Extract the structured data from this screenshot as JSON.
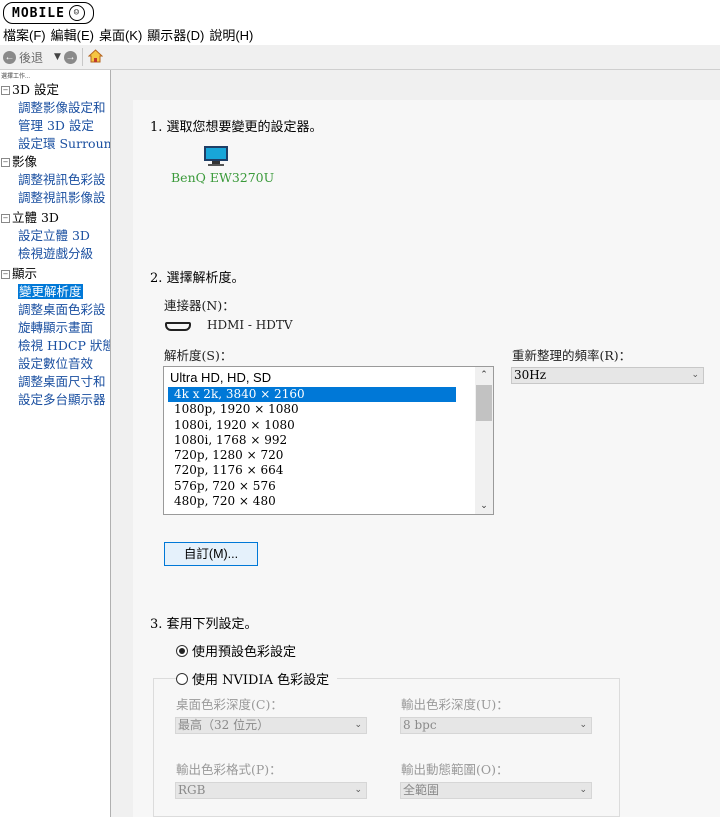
{
  "logo": {
    "text": "MOBILE",
    "face": "☺"
  },
  "menu": {
    "items": [
      "檔案(F)",
      "編輯(E)",
      "桌面(K)",
      "顯示器(D)",
      "說明(H)"
    ]
  },
  "toolbar": {
    "back_label": "後退",
    "back_icon": "arrow-left-icon",
    "forward_icon": "arrow-right-icon",
    "home_icon": "home-icon"
  },
  "sidebar": {
    "caption": "選擇工作...",
    "categories": [
      {
        "label": "3D 設定",
        "items": [
          "調整影像設定和",
          "管理 3D 設定",
          "設定環 Surround"
        ]
      },
      {
        "label": "影像",
        "items": [
          "調整視訊色彩設",
          "調整視訊影像設"
        ]
      },
      {
        "label": "立體 3D",
        "items": [
          "設定立體 3D",
          "檢視遊戲分級"
        ]
      },
      {
        "label": "顯示",
        "items": [
          "變更解析度",
          "調整桌面色彩設",
          "旋轉顯示畫面",
          "檢視 HDCP 狀態",
          "設定數位音效",
          "調整桌面尺寸和",
          "設定多台顯示器"
        ]
      }
    ],
    "selected": "變更解析度"
  },
  "main": {
    "step1": {
      "title": "1. 選取您想要變更的設定器。",
      "monitor_name": "BenQ EW3270U"
    },
    "step2": {
      "title": "2. 選擇解析度。",
      "connector_label": "連接器(N)：",
      "connector_value": "HDMI - HDTV",
      "resolution_label": "解析度(S)：",
      "refresh_label": "重新整理的頻率(R)：",
      "refresh_value": "30Hz",
      "resolution_group": "Ultra HD, HD, SD",
      "resolutions": [
        "4k x 2k, 3840 × 2160",
        "1080p, 1920 × 1080",
        "1080i, 1920 × 1080",
        "1080i, 1768 × 992",
        "720p, 1280 × 720",
        "720p, 1176 × 664",
        "576p, 720 × 576",
        "480p, 720 × 480"
      ],
      "selected_resolution": "4k x 2k, 3840 × 2160",
      "custom_button": "自訂(M)..."
    },
    "step3": {
      "title": "3. 套用下列設定。",
      "radio_default": "使用預設色彩設定",
      "radio_nvidia": "使用 NVIDIA 色彩設定",
      "selected_radio": "default",
      "desktop_depth_label": "桌面色彩深度(C)：",
      "desktop_depth_value": "最高（32 位元）",
      "output_depth_label": "輸出色彩深度(U)：",
      "output_depth_value": "8 bpc",
      "output_format_label": "輸出色彩格式(P)：",
      "output_format_value": "RGB",
      "dynamic_range_label": "輸出動態範圍(O)：",
      "dynamic_range_value": "全範圍"
    }
  },
  "colors": {
    "selection": "#0078d7",
    "monitor_label": "#3a9a3a",
    "tree_item": "#1a4fa0"
  }
}
